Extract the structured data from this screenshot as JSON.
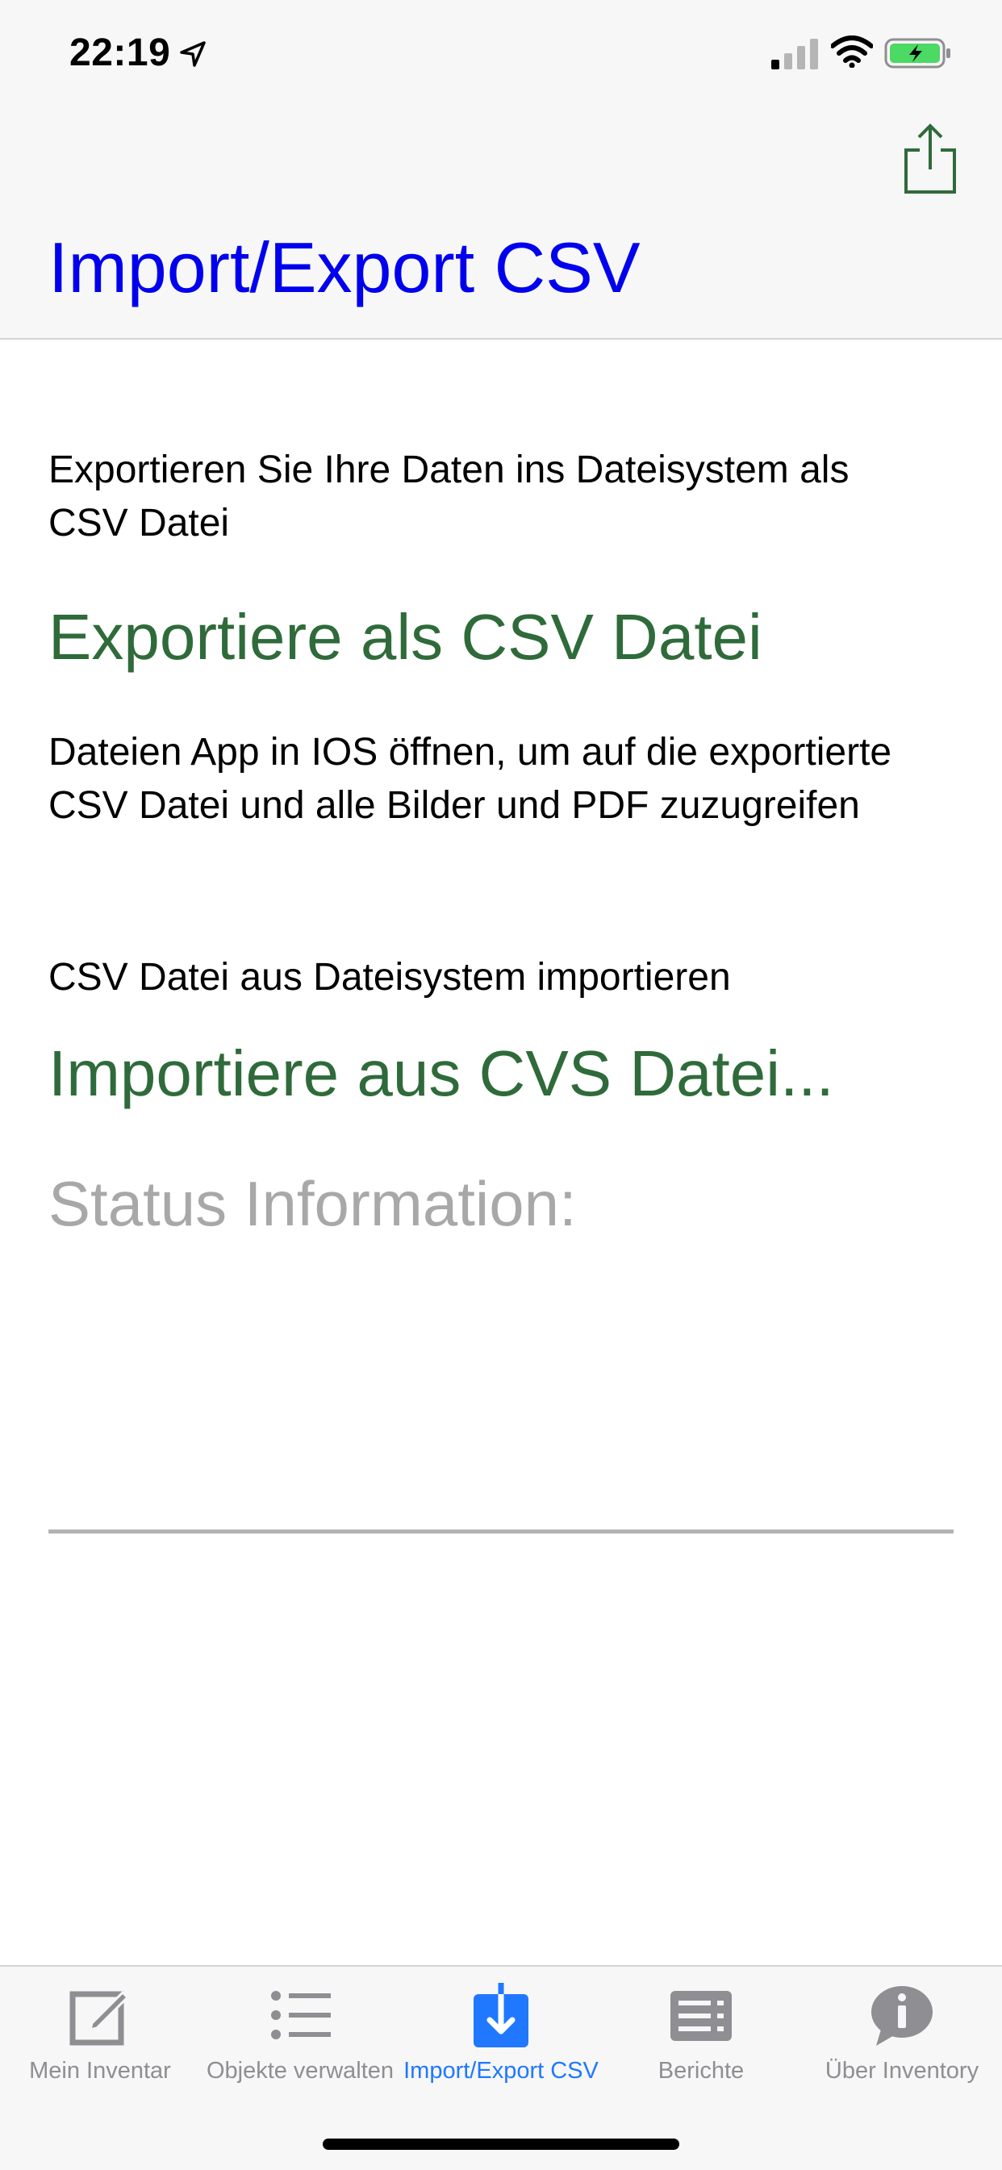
{
  "status_bar": {
    "time": "22:19",
    "icons": [
      "location-icon",
      "cellular-signal-icon",
      "wifi-icon",
      "battery-charging-icon"
    ],
    "battery_color": "#4cd964"
  },
  "nav": {
    "title": "Import/Export CSV",
    "title_color": "#0000ee",
    "share_icon": "share-icon"
  },
  "content": {
    "export_description": "Exportieren Sie Ihre Daten ins Dateisystem als CSV Datei",
    "export_action": "Exportiere als CSV Datei",
    "files_hint": "Dateien App in IOS öffnen, um auf die exportierte CSV Datei und alle Bilder und PDF zuzugreifen",
    "import_description": "CSV Datei aus Dateisystem importieren",
    "import_action": "Importiere aus CVS Datei...",
    "status_label": "Status Information:",
    "action_color": "#2f6b3a"
  },
  "tabs": [
    {
      "label": "Mein Inventar",
      "icon": "compose-icon",
      "active": false
    },
    {
      "label": "Objekte verwalten",
      "icon": "list-icon",
      "active": false
    },
    {
      "label": "Import/Export CSV",
      "icon": "download-icon",
      "active": true
    },
    {
      "label": "Berichte",
      "icon": "report-icon",
      "active": false
    },
    {
      "label": "Über Inventory",
      "icon": "info-icon",
      "active": false
    }
  ],
  "colors": {
    "tab_active": "#1f78ff",
    "tab_inactive": "#8e8e93"
  }
}
